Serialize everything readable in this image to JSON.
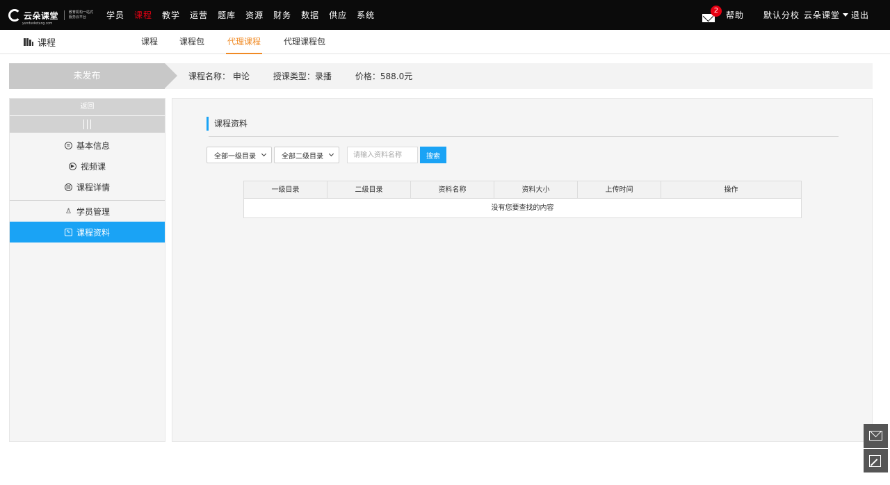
{
  "topbar": {
    "logo_name": "云朵课堂",
    "logo_domain": "yunduoketang.com",
    "logo_slogan": "教育机构一站式服务云平台",
    "nav": [
      "学员",
      "课程",
      "教学",
      "运营",
      "题库",
      "资源",
      "财务",
      "数据",
      "供应",
      "系统"
    ],
    "nav_active": "课程",
    "mail_count": "2",
    "help": "帮助",
    "school": "默认分校",
    "user": "云朵课堂",
    "logout": "退出"
  },
  "subbar": {
    "title": "课程",
    "tabs": [
      "课程",
      "课程包",
      "代理课程",
      "代理课程包"
    ],
    "active_tab": "代理课程"
  },
  "strip": {
    "status": "未发布",
    "course_name": "课程名称： 申论",
    "teach_type": "授课类型：录播",
    "price": "价格：588.0元"
  },
  "sidebar": {
    "back": "返回",
    "items": [
      {
        "label": "基本信息",
        "icon": "list-circle-icon"
      },
      {
        "label": "视频课",
        "icon": "play-circle-icon"
      },
      {
        "label": "课程详情",
        "icon": "detail-circle-icon"
      },
      {
        "label": "学员管理",
        "icon": "users-icon"
      },
      {
        "label": "课程资料",
        "icon": "edit-doc-icon"
      }
    ],
    "active": "课程资料"
  },
  "main": {
    "section_title": "课程资料",
    "filter_level1": "全部一级目录",
    "filter_level2": "全部二级目录",
    "search_placeholder": "请输入资料名称",
    "search_button": "搜索",
    "table": {
      "headers": [
        "一级目录",
        "二级目录",
        "资料名称",
        "资料大小",
        "上传时间",
        "操作"
      ],
      "empty_text": "没有您要查找的内容"
    }
  },
  "colors": {
    "accent": "#1aa3f5",
    "nav_active": "#e60012",
    "tab_active": "#f08a24",
    "topbar_bg": "#0b0b0b"
  }
}
